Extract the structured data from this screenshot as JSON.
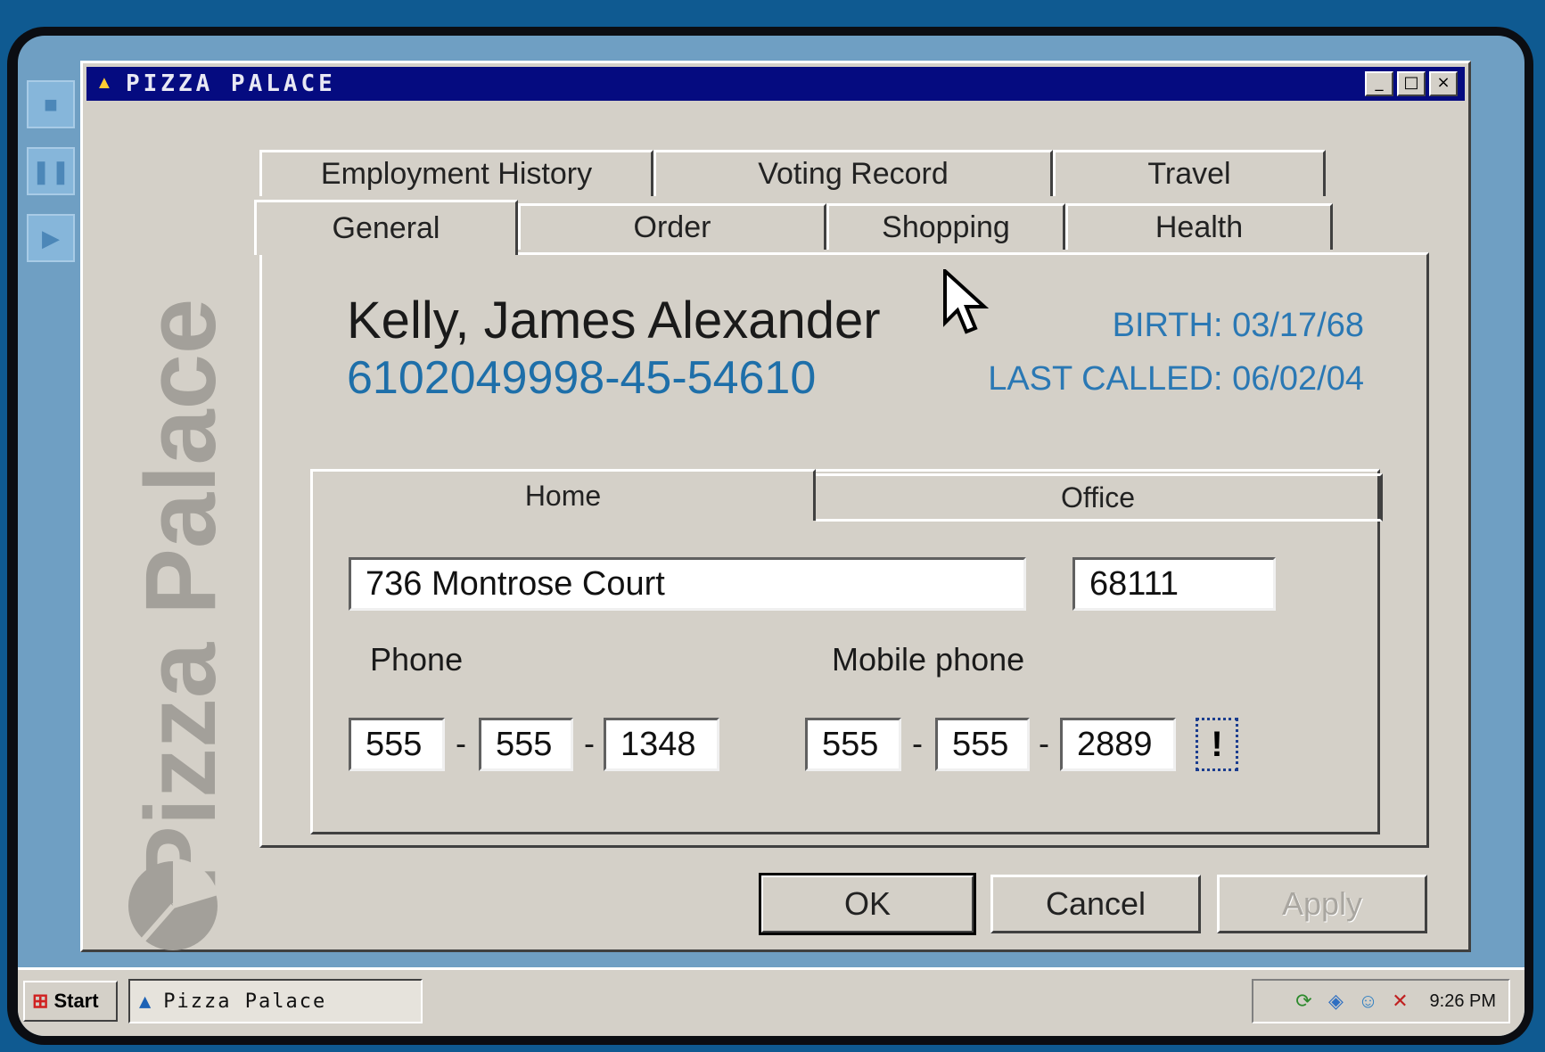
{
  "window": {
    "title": "PIZZA PALACE",
    "min": "_",
    "max": "□",
    "close": "×"
  },
  "brand": {
    "text": "Pizza Palace"
  },
  "tabs": {
    "back_row": [
      "Employment History",
      "Voting Record",
      "Travel"
    ],
    "front_row": [
      "General",
      "Order",
      "Shopping",
      "Health"
    ],
    "active": "General"
  },
  "customer": {
    "name": "Kelly, James Alexander",
    "account": "6102049998-45-54610",
    "birth": "BIRTH: 03/17/68",
    "last_called": "LAST CALLED: 06/02/04"
  },
  "address_tabs": {
    "home": "Home",
    "office": "Office"
  },
  "address": {
    "street": "736 Montrose Court",
    "zip": "68111"
  },
  "phone": {
    "label": "Phone",
    "area": "555",
    "prefix": "555",
    "line": "1348"
  },
  "mobile": {
    "label": "Mobile phone",
    "area": "555",
    "prefix": "555",
    "line": "2889",
    "alert": "!"
  },
  "dash": "-",
  "buttons": {
    "ok": "OK",
    "cancel": "Cancel",
    "apply": "Apply"
  },
  "taskbar": {
    "start": "Start",
    "task": "Pizza Palace",
    "clock": "9:26 PM"
  }
}
